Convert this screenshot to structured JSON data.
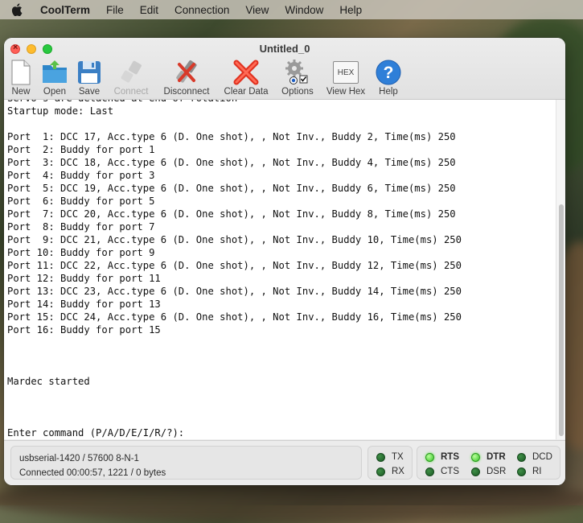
{
  "menubar": {
    "app_name": "CoolTerm",
    "items": [
      "File",
      "Edit",
      "Connection",
      "View",
      "Window",
      "Help"
    ]
  },
  "window": {
    "title": "Untitled_0"
  },
  "toolbar": {
    "new": "New",
    "open": "Open",
    "save": "Save",
    "connect": "Connect",
    "disconnect": "Disconnect",
    "clear_data": "Clear Data",
    "options": "Options",
    "view_hex": "View Hex",
    "help": "Help",
    "hex_icon_text": "HEX"
  },
  "terminal": {
    "lines": [
      "Servo's are detached at end of rotation",
      "Startup mode: Last",
      "",
      "Port  1: DCC 17, Acc.type 6 (D. One shot), , Not Inv., Buddy 2, Time(ms) 250",
      "Port  2: Buddy for port 1",
      "Port  3: DCC 18, Acc.type 6 (D. One shot), , Not Inv., Buddy 4, Time(ms) 250",
      "Port  4: Buddy for port 3",
      "Port  5: DCC 19, Acc.type 6 (D. One shot), , Not Inv., Buddy 6, Time(ms) 250",
      "Port  6: Buddy for port 5",
      "Port  7: DCC 20, Acc.type 6 (D. One shot), , Not Inv., Buddy 8, Time(ms) 250",
      "Port  8: Buddy for port 7",
      "Port  9: DCC 21, Acc.type 6 (D. One shot), , Not Inv., Buddy 10, Time(ms) 250",
      "Port 10: Buddy for port 9",
      "Port 11: DCC 22, Acc.type 6 (D. One shot), , Not Inv., Buddy 12, Time(ms) 250",
      "Port 12: Buddy for port 11",
      "Port 13: DCC 23, Acc.type 6 (D. One shot), , Not Inv., Buddy 14, Time(ms) 250",
      "Port 14: Buddy for port 13",
      "Port 15: DCC 24, Acc.type 6 (D. One shot), , Not Inv., Buddy 16, Time(ms) 250",
      "Port 16: Buddy for port 15",
      "",
      "",
      "",
      "Mardec started",
      "",
      "",
      "",
      "Enter command (P/A/D/E/I/R/?):"
    ]
  },
  "status": {
    "port_settings": "usbserial-1420 / 57600 8-N-1",
    "connection_info": "Connected 00:00:57, 1221 / 0 bytes"
  },
  "signals": {
    "tx": "TX",
    "rx": "RX",
    "rts": "RTS",
    "cts": "CTS",
    "dtr": "DTR",
    "dsr": "DSR",
    "dcd": "DCD",
    "ri": "RI"
  },
  "colors": {
    "led_active": "#39c52a",
    "led_inactive": "#1c5a25",
    "close": "#ff5f57",
    "minimize": "#febc2e",
    "zoom": "#28c840"
  }
}
